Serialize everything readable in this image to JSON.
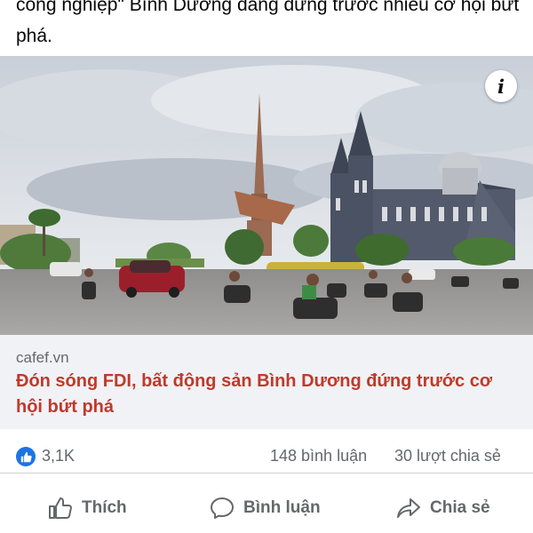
{
  "post": {
    "text": "công nghiệp\" Bình Dương đang đứng trước nhiều cơ hội bứt phá."
  },
  "link_preview": {
    "info_icon": "info-icon",
    "info_label": "i",
    "domain": "cafef.vn",
    "headline": "Đón sóng FDI, bất động sản Bình Dương đứng trước cơ hội bứt phá"
  },
  "stats": {
    "reactions": "3,1K",
    "comments": "148 bình luận",
    "shares": "30 lượt chia sẻ"
  },
  "actions": {
    "like": "Thích",
    "comment": "Bình luận",
    "share": "Chia sẻ"
  },
  "colors": {
    "like_blue": "#1b74e4",
    "headline_red": "#c0392b",
    "secondary_text": "#65676b"
  }
}
